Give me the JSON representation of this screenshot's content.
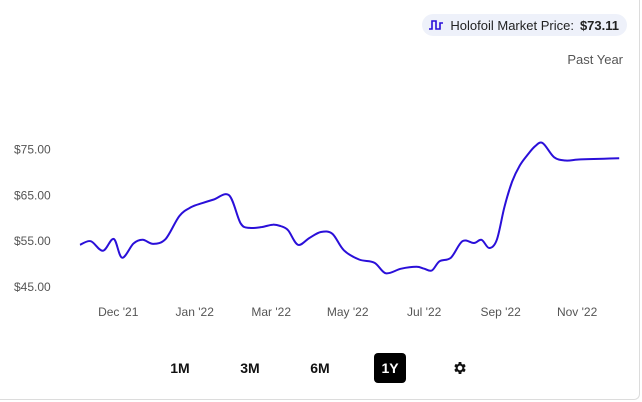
{
  "price_chip": {
    "label": "Holofoil Market Price:",
    "value": "$73.11",
    "icon": "line-chart-icon"
  },
  "period_label": "Past Year",
  "controls": {
    "ranges": [
      "1M",
      "3M",
      "6M",
      "1Y"
    ],
    "active": "1Y",
    "settings_icon": "gear-icon"
  },
  "colors": {
    "line": "#2a0fd9",
    "grid": "#e6e6e6",
    "chip_bg": "#eef1fa"
  },
  "chart_data": {
    "type": "line",
    "y_ticks": [
      75,
      65,
      55,
      45
    ],
    "y_tick_labels": [
      "$75.00",
      "$65.00",
      "$55.00",
      "$45.00"
    ],
    "ylim": [
      45,
      81
    ],
    "x_tick_labels": [
      "Dec '21",
      "Jan '22",
      "Mar '22",
      "May '22",
      "Jul '22",
      "Sep '22",
      "Nov '22"
    ],
    "x_tick_positions": [
      0.5,
      1.5,
      2.5,
      3.5,
      4.5,
      5.5,
      6.5
    ],
    "xlim": [
      0.0,
      7.1
    ],
    "series": [
      {
        "x": [
          0.0,
          0.14,
          0.3,
          0.44,
          0.55,
          0.7,
          0.82,
          0.96,
          1.12,
          1.3,
          1.45,
          1.6,
          1.75,
          1.95,
          2.1,
          2.22,
          2.38,
          2.52,
          2.62,
          2.72,
          2.85,
          3.0,
          3.15,
          3.3,
          3.45,
          3.65,
          3.85,
          4.0,
          4.2,
          4.4,
          4.5,
          4.6,
          4.7,
          4.85,
          5.0,
          5.15,
          5.25,
          5.35,
          5.45,
          5.55,
          5.65,
          5.75,
          5.85,
          5.95,
          6.05,
          6.2,
          6.35,
          6.5,
          6.65,
          6.85,
          7.05
        ],
        "y": [
          54.2,
          55.0,
          52.9,
          55.5,
          51.4,
          54.5,
          55.3,
          54.4,
          55.5,
          60.5,
          62.4,
          63.3,
          64.1,
          65.0,
          58.9,
          57.9,
          58.1,
          58.6,
          58.3,
          57.4,
          54.2,
          55.7,
          57.0,
          56.6,
          53.0,
          51.0,
          50.3,
          48.0,
          49.0,
          49.4,
          49.0,
          48.6,
          50.6,
          51.4,
          55.0,
          54.6,
          55.3,
          53.5,
          55.3,
          62.5,
          68.0,
          71.5,
          73.8,
          75.7,
          76.4,
          73.3,
          72.6,
          72.8,
          72.9,
          73.0,
          73.1
        ]
      }
    ],
    "grid": false,
    "legend": "none"
  }
}
